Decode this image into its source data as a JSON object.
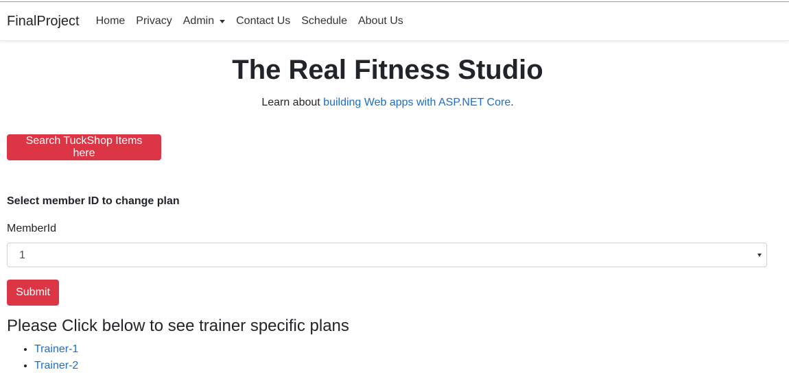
{
  "navbar": {
    "brand": "FinalProject",
    "links": [
      "Home",
      "Privacy",
      "Admin",
      "Contact Us",
      "Schedule",
      "About Us"
    ]
  },
  "hero": {
    "title": "The Real Fitness Studio",
    "learn_prefix": "Learn about ",
    "learn_link": "building Web apps with ASP.NET Core",
    "learn_suffix": "."
  },
  "search_button": "Search TuckShop Items here",
  "member_form": {
    "section_label": "Select member ID to change plan",
    "field_label": "MemberId",
    "selected_value": "1",
    "submit_label": "Submit"
  },
  "trainers": {
    "heading": "Please Click below to see trainer specific plans",
    "items": [
      "Trainer-1",
      "Trainer-2"
    ]
  },
  "colors": {
    "button": "#dc3545",
    "link": "#1b6ec2"
  }
}
